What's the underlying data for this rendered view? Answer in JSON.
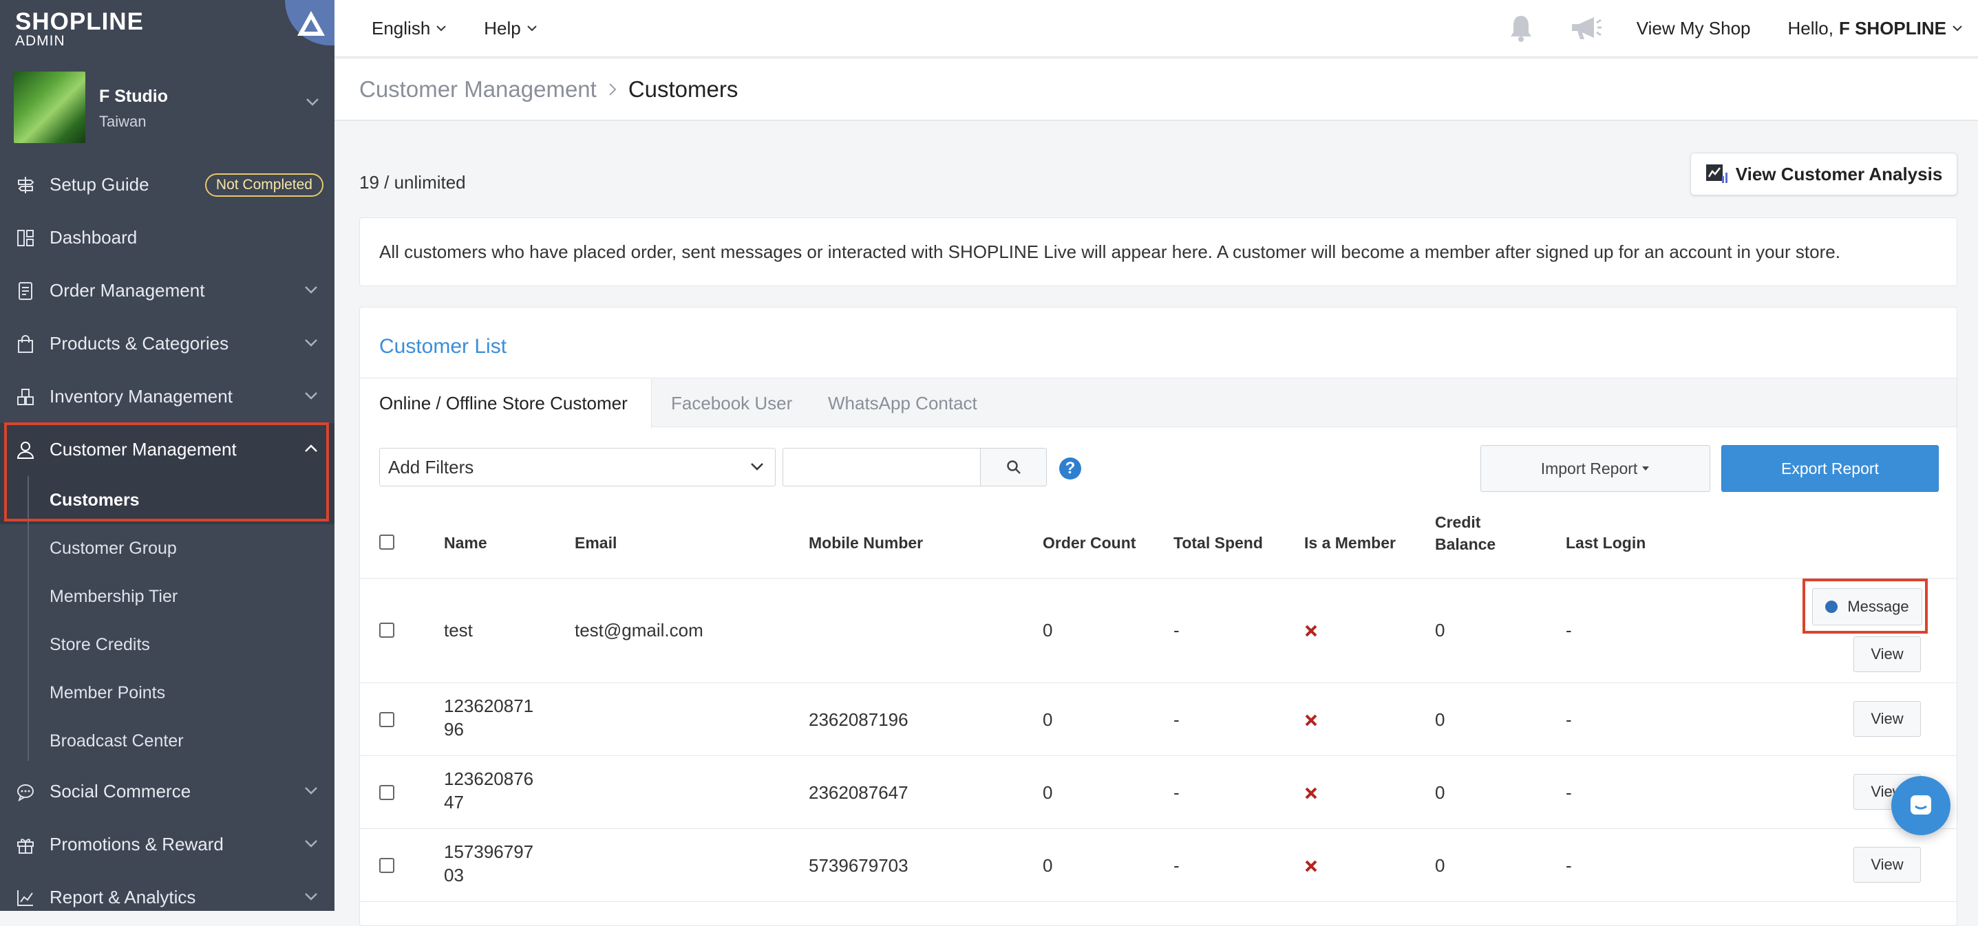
{
  "brand": {
    "name": "SHOPLINE",
    "sub": "ADMIN"
  },
  "store": {
    "name": "F Studio",
    "region": "Taiwan"
  },
  "sidebar": {
    "items": [
      {
        "label": "Setup Guide",
        "badge": "Not Completed"
      },
      {
        "label": "Dashboard"
      },
      {
        "label": "Order Management"
      },
      {
        "label": "Products & Categories"
      },
      {
        "label": "Inventory Management"
      },
      {
        "label": "Customer Management"
      },
      {
        "label": "Social Commerce"
      },
      {
        "label": "Promotions & Reward"
      },
      {
        "label": "Report & Analytics"
      }
    ],
    "sub_items": [
      "Customers",
      "Customer Group",
      "Membership Tier",
      "Store Credits",
      "Member Points",
      "Broadcast Center"
    ]
  },
  "topbar": {
    "language": "English",
    "help": "Help",
    "view_shop": "View My Shop",
    "hello": "Hello,",
    "user": "F SHOPLINE"
  },
  "breadcrumb": {
    "parent": "Customer Management",
    "current": "Customers"
  },
  "summary": {
    "count": "19 / unlimited",
    "analysis_button": "View Customer Analysis",
    "info": "All customers who have placed order, sent messages or interacted with SHOPLINE Live will appear here. A customer will become a member after signed up for an account in your store."
  },
  "customer_list": {
    "title": "Customer List",
    "tabs": [
      "Online / Offline Store Customer",
      "Facebook User",
      "WhatsApp Contact"
    ],
    "filter_placeholder": "Add Filters",
    "help_glyph": "?",
    "import_button": "Import Report",
    "export_button": "Export Report",
    "columns": [
      "Name",
      "Email",
      "Mobile Number",
      "Order Count",
      "Total Spend",
      "Is a Member",
      "Credit",
      "Balance",
      "Last Login"
    ],
    "message_button": "Message",
    "view_button": "View",
    "rows": [
      {
        "name_l1": "test",
        "name_l2": "",
        "email": "test@gmail.com",
        "mobile": "",
        "orders": "0",
        "spend": "-",
        "credit": "0",
        "last_login": "-"
      },
      {
        "name_l1": "123620871",
        "name_l2": "96",
        "email": "",
        "mobile": "2362087196",
        "orders": "0",
        "spend": "-",
        "credit": "0",
        "last_login": "-"
      },
      {
        "name_l1": "123620876",
        "name_l2": "47",
        "email": "",
        "mobile": "2362087647",
        "orders": "0",
        "spend": "-",
        "credit": "0",
        "last_login": "-"
      },
      {
        "name_l1": "157396797",
        "name_l2": "03",
        "email": "",
        "mobile": "5739679703",
        "orders": "0",
        "spend": "-",
        "credit": "0",
        "last_login": "-"
      }
    ]
  },
  "colors": {
    "sidebar": "#3f4654",
    "accent": "#3a8ed8",
    "highlight": "#d9442d",
    "not_member": "#b3261e"
  }
}
